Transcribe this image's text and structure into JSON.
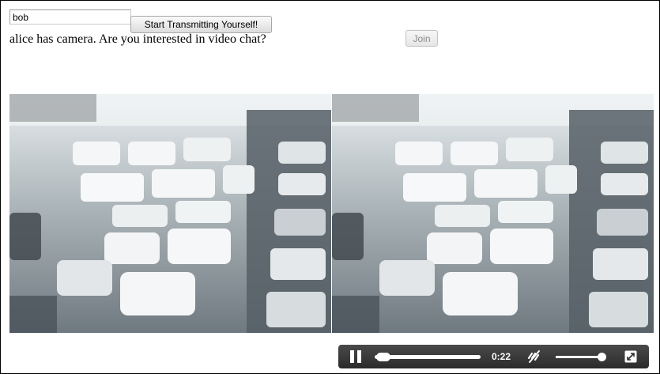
{
  "form": {
    "name_value": "bob",
    "transmit_button": "Start Transmitting Yourself!"
  },
  "status": {
    "message": "alice has camera. Are you interested in video chat?",
    "join_button": "Join"
  },
  "player": {
    "time": "0:22",
    "progress": 0.03,
    "volume": 0.9,
    "icons": [
      "pause-icon",
      "mute-icon",
      "fullscreen-icon"
    ]
  },
  "colors": {
    "controls_bar": "#333333",
    "controls_fg": "#ffffff"
  }
}
